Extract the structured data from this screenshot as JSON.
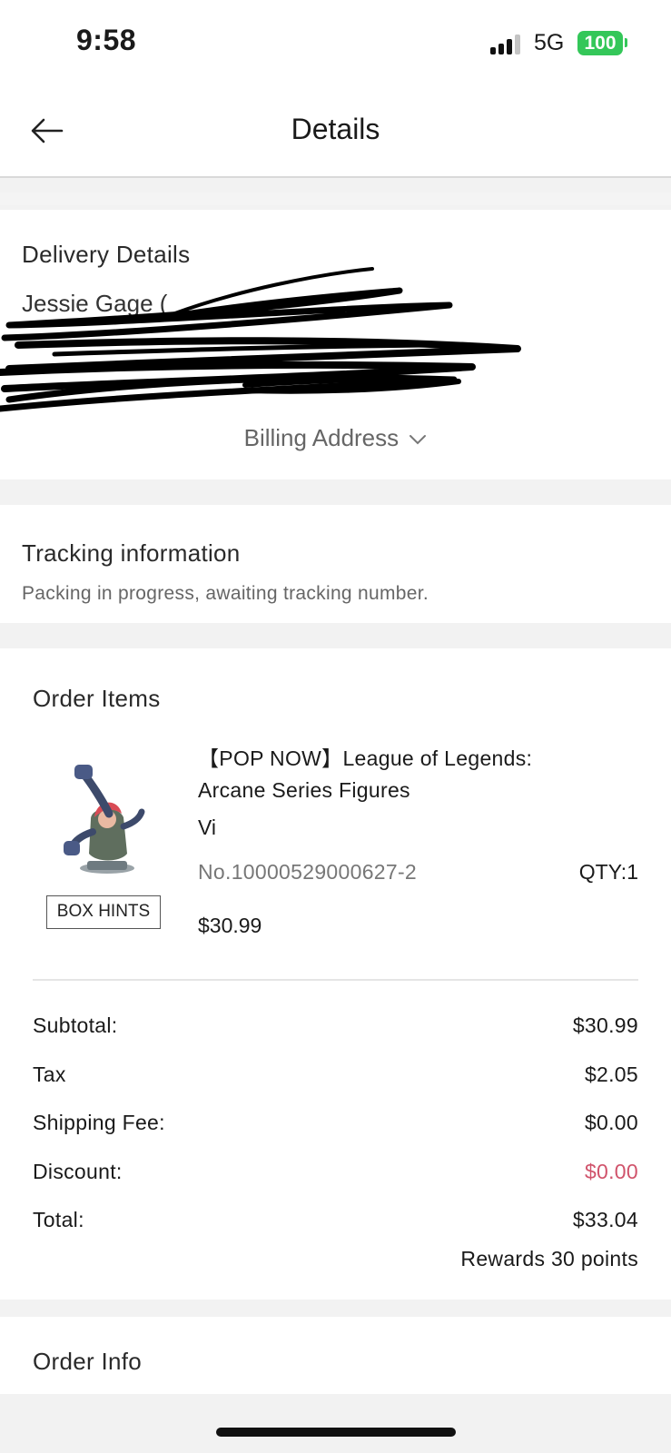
{
  "status_bar": {
    "time": "9:58",
    "network": "5G",
    "battery": "100",
    "battery_color": "#34c759"
  },
  "header": {
    "title": "Details",
    "back_icon": "arrow-left-icon"
  },
  "delivery": {
    "title": "Delivery Details",
    "name_line": "Jessie Gage (",
    "billing_label": "Billing Address",
    "billing_icon": "chevron-down-icon"
  },
  "tracking": {
    "title": "Tracking information",
    "status": "Packing in progress, awaiting tracking number."
  },
  "order_items": {
    "title": "Order Items",
    "items": [
      {
        "name_line1": "【POP NOW】League of Legends:",
        "name_line2": "Arcane Series Figures",
        "variant": "Vi",
        "sku": "No.10000529000627-2",
        "qty": "QTY:1",
        "price": "$30.99",
        "box_hints_label": "BOX HINTS"
      }
    ]
  },
  "summary": {
    "subtotal_label": "Subtotal:",
    "subtotal": "$30.99",
    "tax_label": "Tax",
    "tax": "$2.05",
    "shipping_label": "Shipping Fee:",
    "shipping": "$0.00",
    "discount_label": "Discount:",
    "discount": "$0.00",
    "discount_color": "#d0536b",
    "total_label": "Total:",
    "total": "$33.04",
    "rewards": "Rewards 30 points"
  },
  "order_info": {
    "title": "Order Info"
  }
}
